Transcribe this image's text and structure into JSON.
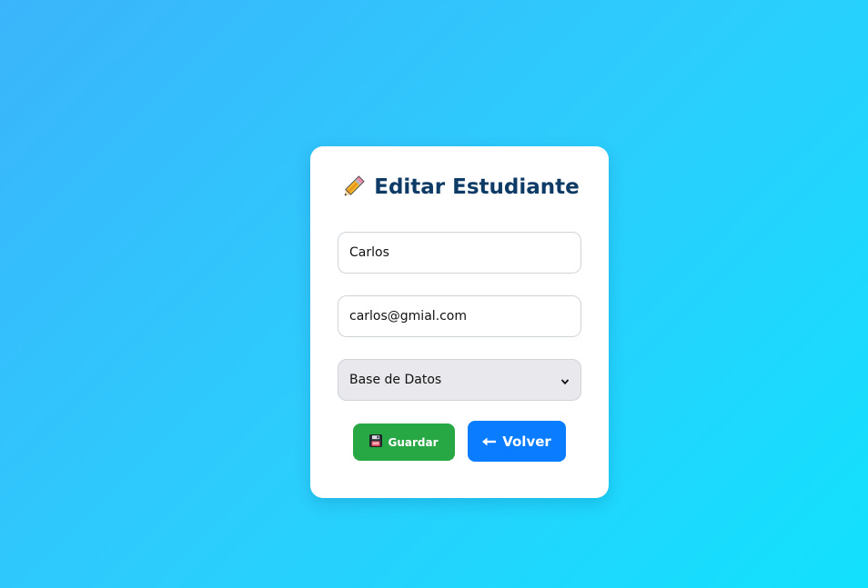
{
  "form": {
    "title": "Editar Estudiante",
    "title_icon": "pencil-icon",
    "name_value": "Carlos",
    "email_value": "carlos@gmial.com",
    "course_selected": "Base de Datos",
    "save_label": "Guardar",
    "save_icon": "floppy-disk-icon",
    "back_label": "Volver",
    "back_icon": "arrow-left-icon"
  },
  "colors": {
    "title": "#0d3b66",
    "save_button": "#28a745",
    "back_button": "#0a7cff",
    "select_background": "#e8e8ed"
  }
}
